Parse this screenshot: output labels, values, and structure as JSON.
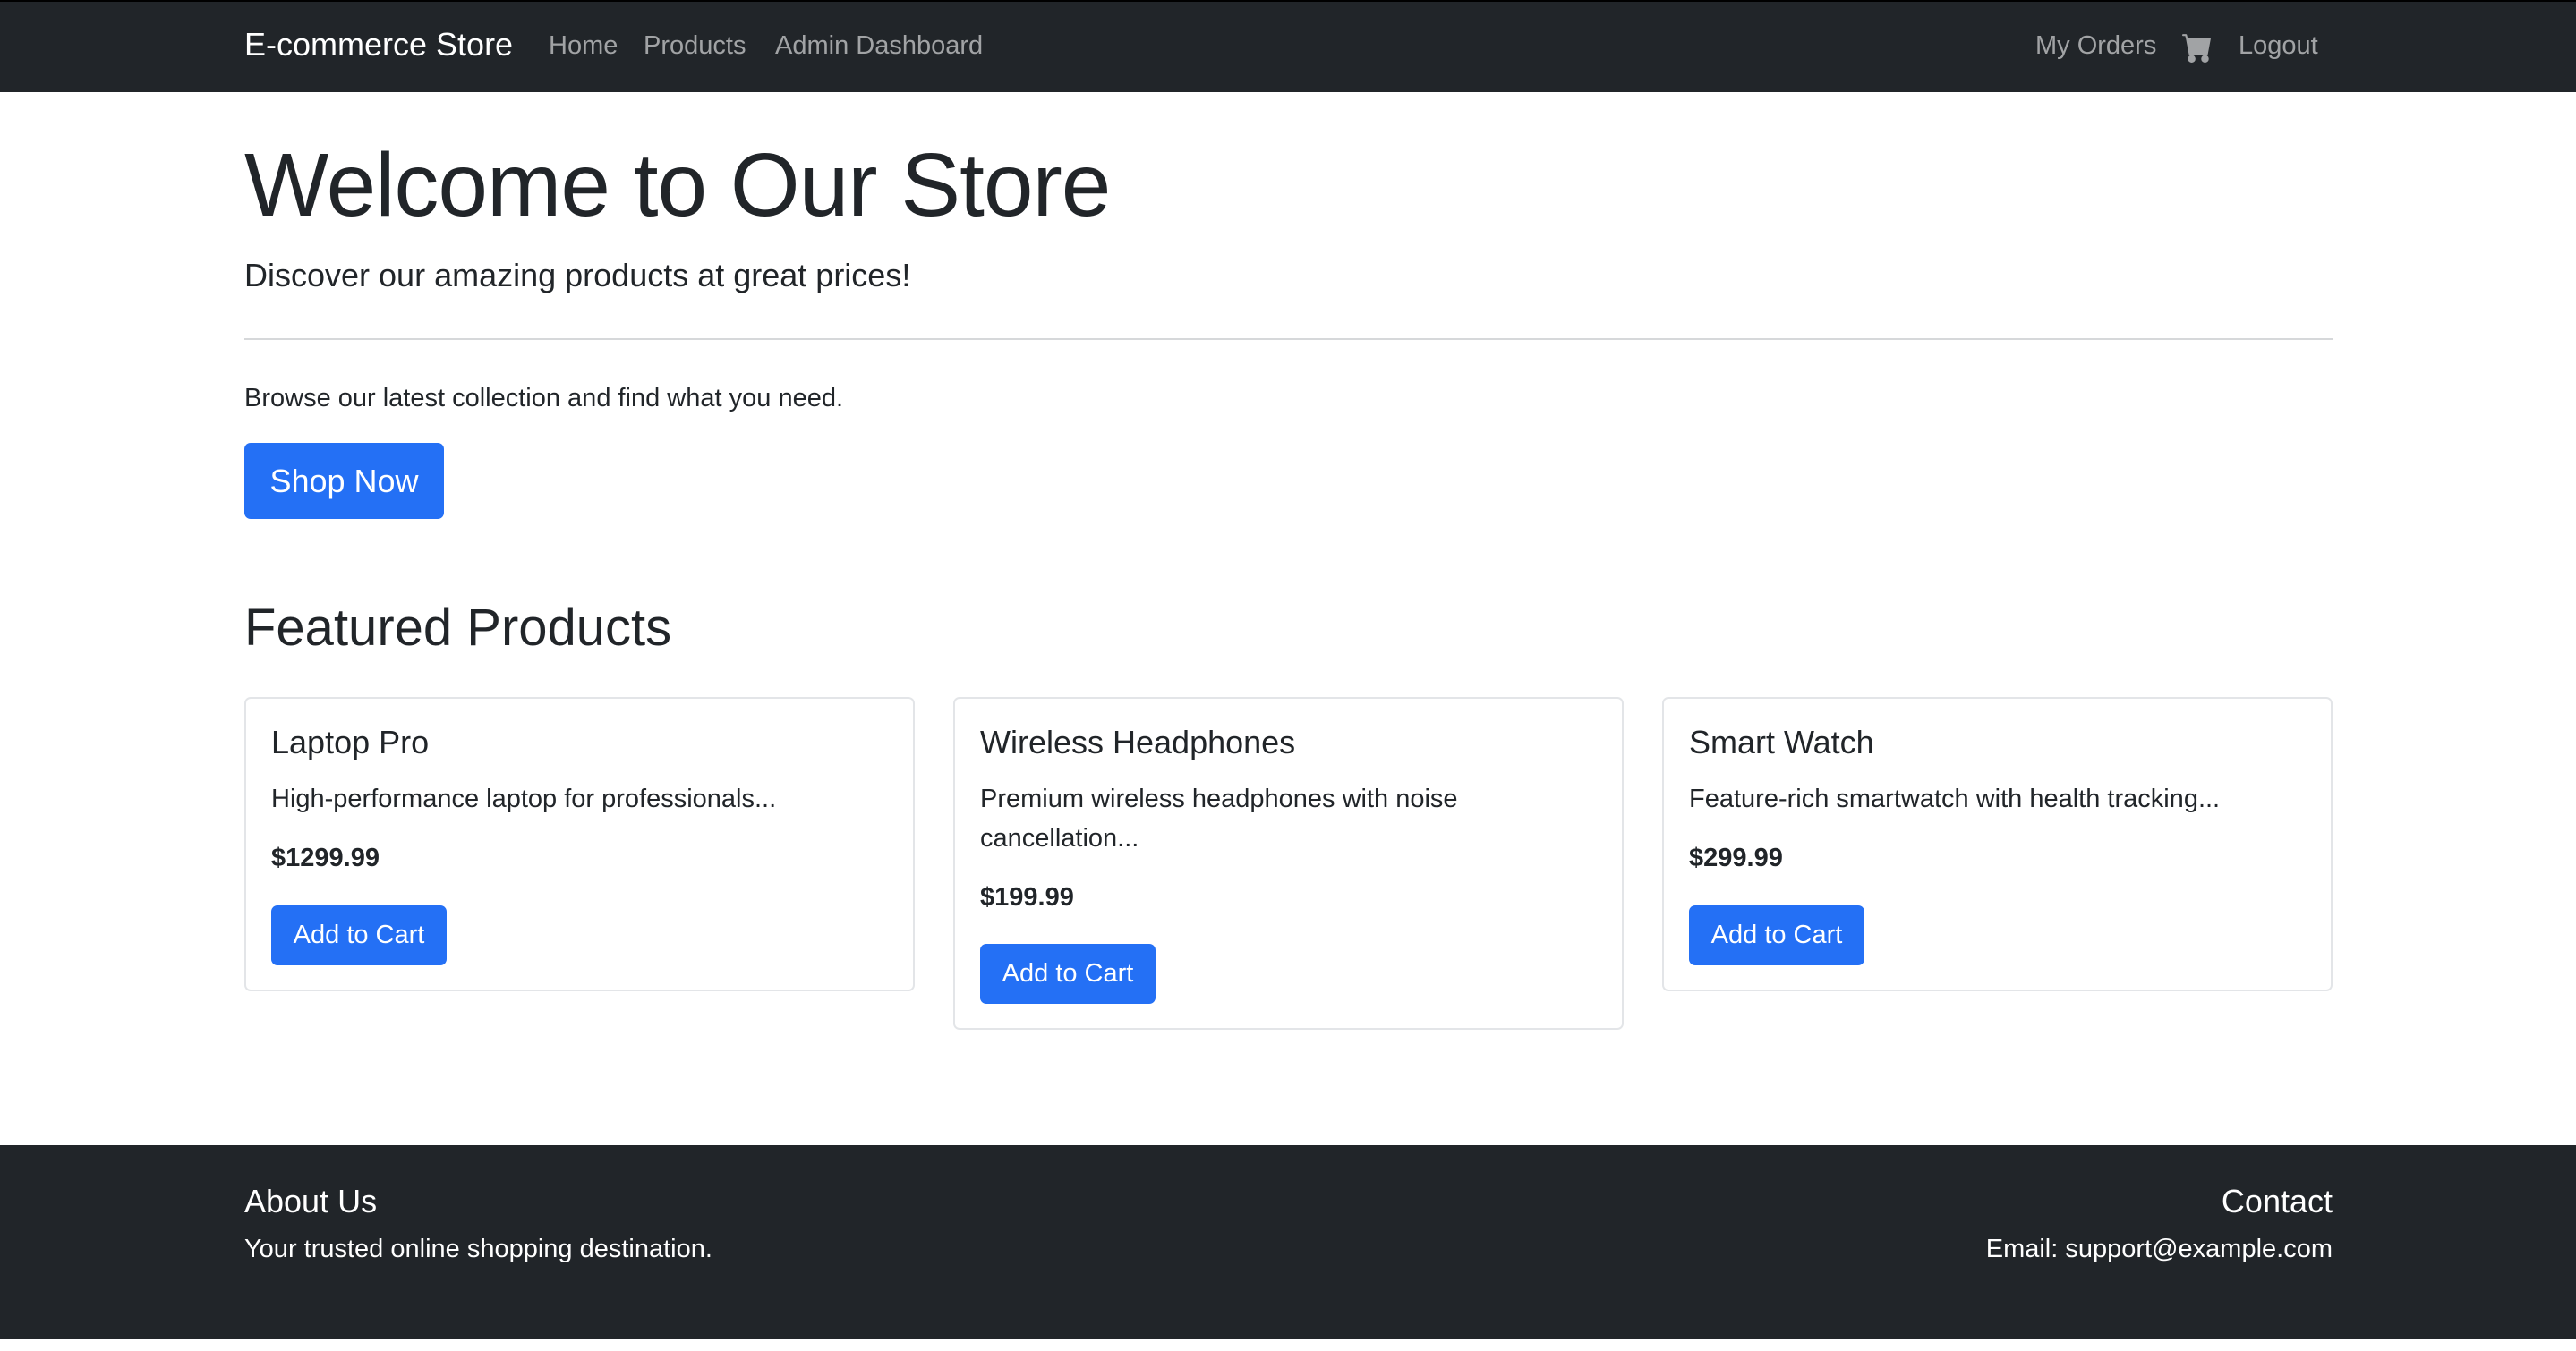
{
  "navbar": {
    "brand": "E-commerce Store",
    "links": [
      {
        "label": "Home"
      },
      {
        "label": "Products"
      },
      {
        "label": "Admin Dashboard"
      }
    ],
    "right_links": {
      "orders": "My Orders",
      "cart_icon": "shopping-cart-icon",
      "logout": "Logout"
    }
  },
  "hero": {
    "title": "Welcome to Our Store",
    "lead": "Discover our amazing products at great prices!",
    "text": "Browse our latest collection and find what you need.",
    "button": "Shop Now"
  },
  "featured": {
    "title": "Featured Products",
    "products": [
      {
        "name": "Laptop Pro",
        "description": "High-performance laptop for professionals...",
        "price": "$1299.99",
        "button": "Add to Cart"
      },
      {
        "name": "Wireless Headphones",
        "description": "Premium wireless headphones with noise cancellation...",
        "price": "$199.99",
        "button": "Add to Cart"
      },
      {
        "name": "Smart Watch",
        "description": "Feature-rich smartwatch with health tracking...",
        "price": "$299.99",
        "button": "Add to Cart"
      }
    ]
  },
  "footer": {
    "about_title": "About Us",
    "about_text": "Your trusted online shopping destination.",
    "contact_title": "Contact",
    "contact_text": "Email: support@example.com"
  },
  "colors": {
    "navbar_bg": "#212529",
    "primary": "#2470f5",
    "text": "#212529"
  }
}
